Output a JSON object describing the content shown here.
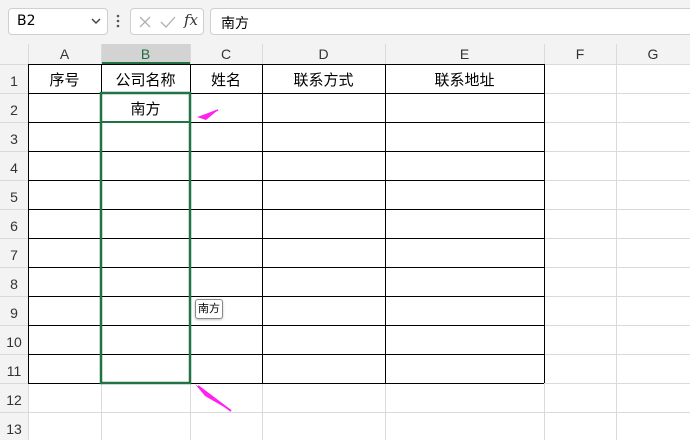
{
  "formula_bar": {
    "name_box": "B2",
    "formula_value": "南方",
    "fx_label": "fx"
  },
  "columns": [
    "A",
    "B",
    "C",
    "D",
    "E",
    "F",
    "G"
  ],
  "rows": [
    "1",
    "2",
    "3",
    "4",
    "5",
    "6",
    "7",
    "8",
    "9",
    "10",
    "11",
    "12",
    "13"
  ],
  "headers": {
    "A1": "序号",
    "B1": "公司名称",
    "C1": "姓名",
    "D1": "联系方式",
    "E1": "联系地址"
  },
  "cells": {
    "B2": "南方"
  },
  "autofill_tip": "南方",
  "colors": {
    "selection": "#217346",
    "annotation_arrow": "#ff22ee",
    "header_bg": "#f3f3f3",
    "selected_header_bg": "#d3d3d3"
  },
  "icons": [
    "chevron-down-icon",
    "more-options-icon",
    "cancel-icon",
    "confirm-icon",
    "function-icon",
    "arrow-annotation-icon"
  ]
}
